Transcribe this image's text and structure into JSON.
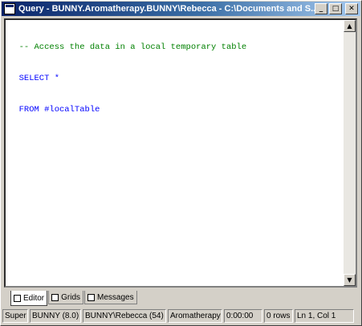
{
  "window": {
    "title": "Query - BUNNY.Aromatherapy.BUNNY\\Rebecca - C:\\Documents and S...",
    "controls": {
      "minimize": "_",
      "maximize": "□",
      "close": "✕"
    }
  },
  "editor": {
    "lines": [
      "  -- Access the data in a local temporary table",
      "  SELECT *",
      "  FROM #localTable"
    ]
  },
  "scroll": {
    "up": "▲",
    "down": "▼"
  },
  "tabs": [
    {
      "label": "Editor"
    },
    {
      "label": "Grids"
    },
    {
      "label": "Messages"
    }
  ],
  "status": {
    "mode": "Super",
    "server": "BUNNY (8.0)",
    "user": "BUNNY\\Rebecca (54)",
    "database": "Aromatherapy",
    "elapsed": "0:00:00",
    "rows": "0 rows",
    "position": "Ln 1, Col 1"
  }
}
